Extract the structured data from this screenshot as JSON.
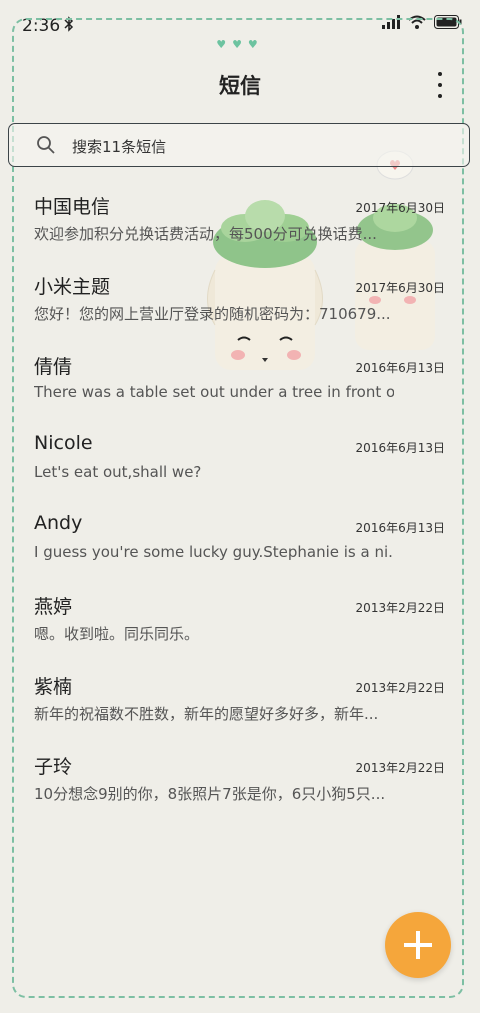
{
  "status_bar": {
    "time": "2:36"
  },
  "header": {
    "title": "短信"
  },
  "search": {
    "placeholder": "搜索11条短信"
  },
  "messages": [
    {
      "name": "中国电信",
      "date": "2017年6月30日",
      "preview": "欢迎参加积分兑换话费活动，每500分可兑换话费..."
    },
    {
      "name": "小米主题",
      "date": "2017年6月30日",
      "preview": "您好！您的网上营业厅登录的随机密码为：710679..."
    },
    {
      "name": "倩倩",
      "date": "2016年6月13日",
      "preview": "There was a table set out under a tree in front o..."
    },
    {
      "name": "Nicole",
      "date": "2016年6月13日",
      "preview": "Let's eat out,shall we?"
    },
    {
      "name": "Andy",
      "date": "2016年6月13日",
      "preview": "I guess you're some lucky guy.Stephanie is a ni..."
    },
    {
      "name": "燕婷",
      "date": "2013年2月22日",
      "preview": "嗯。收到啦。同乐同乐。"
    },
    {
      "name": "紫楠",
      "date": "2013年2月22日",
      "preview": "新年的祝福数不胜数，新年的愿望好多好多，新年..."
    },
    {
      "name": "子玲",
      "date": "2013年2月22日",
      "preview": "10分想念9别的你，8张照片7张是你，6只小狗5只..."
    }
  ],
  "colors": {
    "accent": "#f5a63b",
    "frame": "#7dbfa3",
    "background": "#efeee8"
  },
  "icons": {
    "bluetooth": "bluetooth-icon",
    "signal": "signal-icon",
    "wifi": "wifi-icon",
    "battery": "battery-icon",
    "search": "search-icon",
    "more": "more-vertical-icon",
    "compose": "plus-icon"
  }
}
